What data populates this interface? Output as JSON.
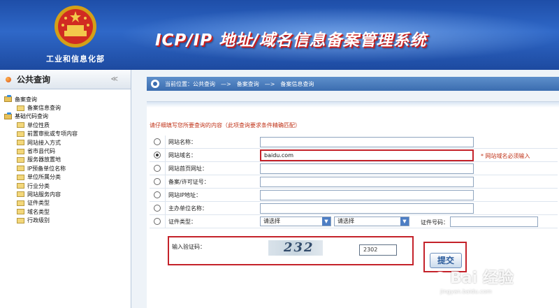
{
  "header": {
    "ministry": "工业和信息化部",
    "system_title": "ICP/IP 地址/域名信息备案管理系统"
  },
  "sidebar": {
    "title": "公共查询",
    "collapse_symbol": "≪",
    "groups": [
      {
        "label": "备案查询",
        "items": [
          "备案信息查询"
        ]
      },
      {
        "label": "基础代码查询",
        "items": [
          "单位性质",
          "前置审批或专项内容",
          "网站接入方式",
          "省市县代码",
          "服务器放置地",
          "IP预备单位名称",
          "单位所属分类",
          "行业分类",
          "网站服务内容",
          "证件类型",
          "域名类型",
          "行政级别"
        ]
      }
    ]
  },
  "breadcrumb": {
    "prefix": "当前位置：公共查询",
    "sep1": "—>",
    "level2": "备案查询",
    "sep2": "—>",
    "level3": "备案信息查询"
  },
  "form": {
    "note": "请仔细填写您所要查询的内容（此项查询要求条件精确匹配）",
    "fields": [
      {
        "label": "网站名称：",
        "value": ""
      },
      {
        "label": "网站域名：",
        "value": "baidu.com",
        "required": "* 网站域名必须输入"
      },
      {
        "label": "网站首页网址：",
        "value": ""
      },
      {
        "label": "备案/许可证号：",
        "value": ""
      },
      {
        "label": "网站IP地址：",
        "value": ""
      },
      {
        "label": "主办单位名称：",
        "value": ""
      },
      {
        "label": "证件类型：",
        "select1": "请选择",
        "select2": "请选择",
        "cert_no_label": "证件号码："
      }
    ],
    "captcha_label": "输入验证码：",
    "captcha_image_text": "232",
    "captcha_value": "2302",
    "submit_label": "提交"
  },
  "watermark": {
    "brand": "Bai 经验",
    "url": "jingyan.baidu.com"
  },
  "colors": {
    "banner_blue": "#2f68c8",
    "highlight_red": "#c4222a",
    "note_red": "#c0341a"
  }
}
